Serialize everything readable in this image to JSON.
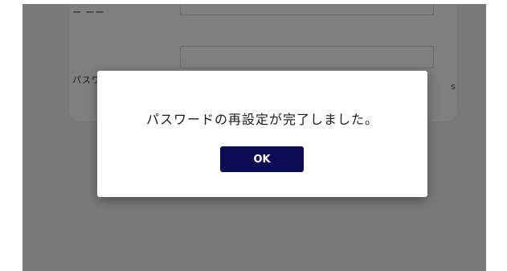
{
  "form": {
    "top_label": "ー ーー",
    "password_label": "パスワード",
    "right_fragment": "s"
  },
  "dialog": {
    "message": "パスワードの再設定が完了しました。",
    "ok_label": "OK"
  },
  "colors": {
    "overlay": "rgba(0,0,0,0.5)",
    "primary_button": "#0d0b54"
  }
}
